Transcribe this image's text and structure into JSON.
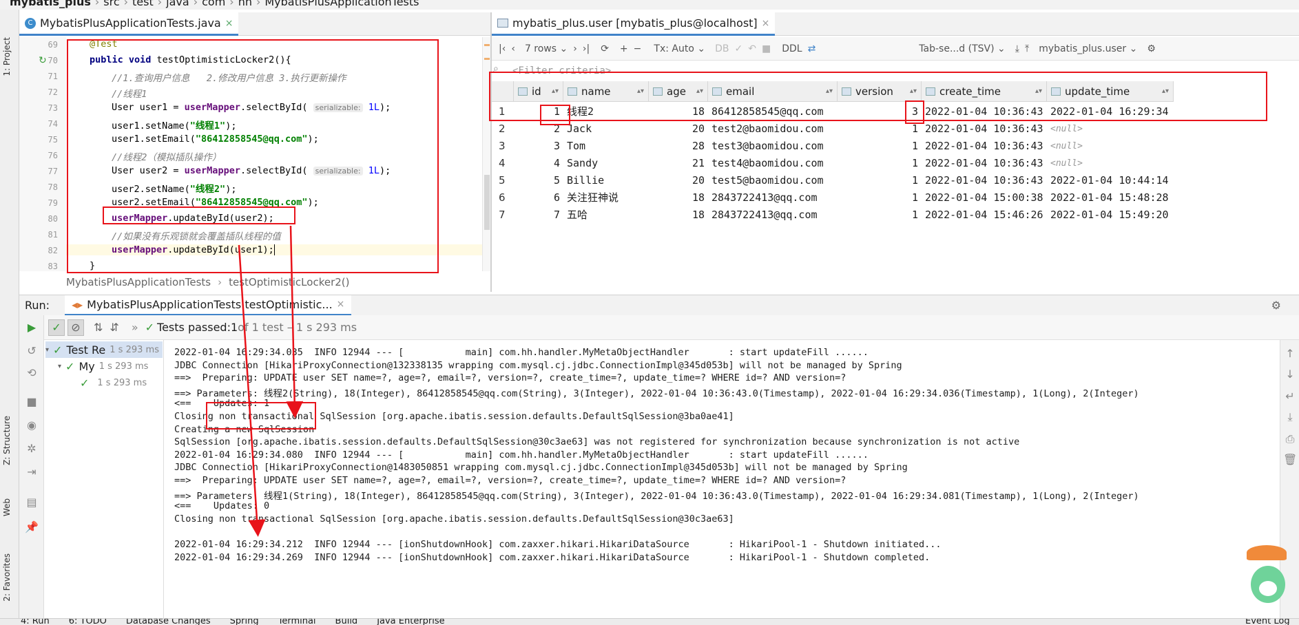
{
  "breadcrumb": [
    "mybatis_plus",
    "src",
    "test",
    "java",
    "com",
    "hh",
    "MybatisPlusApplicationTests"
  ],
  "left_stripe": {
    "project": "1: Project",
    "structure": "Z: Structure",
    "web": "Web",
    "favorites": "2: Favorites"
  },
  "editor": {
    "tab": "MybatisPlusApplicationTests.java",
    "line_numbers": [
      "69",
      "70",
      "71",
      "72",
      "73",
      "74",
      "75",
      "76",
      "77",
      "78",
      "79",
      "80",
      "81",
      "82",
      "83"
    ],
    "crumbs": [
      "MybatisPlusApplicationTests",
      "testOptimisticLocker2()"
    ],
    "code": {
      "l69": "@Test",
      "l70_kw": "public void",
      "l70_rest": " testOptimisticLocker2(){",
      "l71": "//1.查询用户信息   2.修改用户信息 3.执行更新操作",
      "l72": "//线程1",
      "l73_a": "User user1 = ",
      "l73_b": "userMapper",
      "l73_c": ".selectById( ",
      "l73_hint": "serializable:",
      "l73_d": " 1L",
      "l73_e": ");",
      "l74_a": "user1.setName(",
      "l74_b": "\"线程1\"",
      "l74_c": ");",
      "l75_a": "user1.setEmail(",
      "l75_b": "\"86412858545@qq.com\"",
      "l75_c": ");",
      "l76": "//线程2（模拟插队操作）",
      "l77_a": "User user2 = ",
      "l77_b": "userMapper",
      "l77_c": ".selectById( ",
      "l77_hint": "serializable:",
      "l77_d": " 1L",
      "l77_e": ");",
      "l78_a": "user2.setName(",
      "l78_b": "\"线程2\"",
      "l78_c": ");",
      "l79_a": "user2.setEmail(",
      "l79_b": "\"86412858545@qq.com\"",
      "l79_c": ");",
      "l80_a": "userMapper",
      "l80_b": ".updateById(user2);",
      "l81": "//如果没有乐观锁就会覆盖插队线程的值",
      "l82_a": "userMapper",
      "l82_b": ".updateById(user1);",
      "l83": "}"
    }
  },
  "db": {
    "tab": "mybatis_plus.user [mybatis_plus@localhost]",
    "toolbar": {
      "rows": "7 rows",
      "tx": "Tx: Auto",
      "ddl": "DDL",
      "format": "Tab-se...d (TSV)",
      "target": "mybatis_plus.user"
    },
    "filter_placeholder": "<Filter criteria>",
    "columns": [
      "id",
      "name",
      "age",
      "email",
      "version",
      "create_time",
      "update_time"
    ],
    "rows": [
      {
        "n": "1",
        "id": "1",
        "name": "线程2",
        "age": "18",
        "email": "86412858545@qq.com",
        "version": "3",
        "create_time": "2022-01-04 10:36:43",
        "update_time": "2022-01-04 16:29:34"
      },
      {
        "n": "2",
        "id": "2",
        "name": "Jack",
        "age": "20",
        "email": "test2@baomidou.com",
        "version": "1",
        "create_time": "2022-01-04 10:36:43",
        "update_time": "<null>"
      },
      {
        "n": "3",
        "id": "3",
        "name": "Tom",
        "age": "28",
        "email": "test3@baomidou.com",
        "version": "1",
        "create_time": "2022-01-04 10:36:43",
        "update_time": "<null>"
      },
      {
        "n": "4",
        "id": "4",
        "name": "Sandy",
        "age": "21",
        "email": "test4@baomidou.com",
        "version": "1",
        "create_time": "2022-01-04 10:36:43",
        "update_time": "<null>"
      },
      {
        "n": "5",
        "id": "5",
        "name": "Billie",
        "age": "20",
        "email": "test5@baomidou.com",
        "version": "1",
        "create_time": "2022-01-04 10:36:43",
        "update_time": "2022-01-04 10:44:14"
      },
      {
        "n": "6",
        "id": "6",
        "name": "关注狂神说",
        "age": "18",
        "email": "2843722413@qq.com",
        "version": "1",
        "create_time": "2022-01-04 15:00:38",
        "update_time": "2022-01-04 15:48:28"
      },
      {
        "n": "7",
        "id": "7",
        "name": "五哈",
        "age": "18",
        "email": "2843722413@qq.com",
        "version": "1",
        "create_time": "2022-01-04 15:46:26",
        "update_time": "2022-01-04 15:49:20"
      }
    ]
  },
  "run": {
    "label": "Run:",
    "config": "MybatisPlusApplicationTests.testOptimistic...",
    "tests_passed": "Tests passed:",
    "tests_count": " 1",
    "tests_detail": " of 1 test – 1 s 293 ms",
    "tree": [
      {
        "label": "Test Re",
        "time": "1 s 293 ms"
      },
      {
        "label": "My",
        "time": "1 s 293 ms"
      },
      {
        "label": "",
        "time": "1 s 293 ms"
      }
    ],
    "console": [
      "2022-01-04 16:29:34.035  INFO 12944 --- [           main] com.hh.handler.MyMetaObjectHandler       : start updateFill ......",
      "JDBC Connection [HikariProxyConnection@132338135 wrapping com.mysql.cj.jdbc.ConnectionImpl@345d053b] will not be managed by Spring",
      "==>  Preparing: UPDATE user SET name=?, age=?, email=?, version=?, create_time=?, update_time=? WHERE id=? AND version=?",
      "==> Parameters: 线程2(String), 18(Integer), 86412858545@qq.com(String), 3(Integer), 2022-01-04 10:36:43.0(Timestamp), 2022-01-04 16:29:34.036(Timestamp), 1(Long), 2(Integer)",
      "<==    Updates: 1",
      "Closing non transactional SqlSession [org.apache.ibatis.session.defaults.DefaultSqlSession@3ba0ae41]",
      "Creating a new SqlSession",
      "SqlSession [org.apache.ibatis.session.defaults.DefaultSqlSession@30c3ae63] was not registered for synchronization because synchronization is not active",
      "2022-01-04 16:29:34.080  INFO 12944 --- [           main] com.hh.handler.MyMetaObjectHandler       : start updateFill ......",
      "JDBC Connection [HikariProxyConnection@1483050851 wrapping com.mysql.cj.jdbc.ConnectionImpl@345d053b] will not be managed by Spring",
      "==>  Preparing: UPDATE user SET name=?, age=?, email=?, version=?, create_time=?, update_time=? WHERE id=? AND version=?",
      "==> Parameters: 线程1(String), 18(Integer), 86412858545@qq.com(String), 3(Integer), 2022-01-04 10:36:43.0(Timestamp), 2022-01-04 16:29:34.081(Timestamp), 1(Long), 2(Integer)",
      "<==    Updates: 0",
      "Closing non transactional SqlSession [org.apache.ibatis.session.defaults.DefaultSqlSession@30c3ae63]",
      "",
      "2022-01-04 16:29:34.212  INFO 12944 --- [ionShutdownHook] com.zaxxer.hikari.HikariDataSource       : HikariPool-1 - Shutdown initiated...",
      "2022-01-04 16:29:34.269  INFO 12944 --- [ionShutdownHook] com.zaxxer.hikari.HikariDataSource       : HikariPool-1 - Shutdown completed."
    ]
  },
  "bottom_tabs": [
    "4: Run",
    "6: TODO",
    "Database Changes",
    "Spring",
    "Terminal",
    "Build",
    "Java Enterprise",
    "Event Log"
  ],
  "colors": {
    "annotation_red": "#e8131a",
    "pass_green": "#3a9c3a",
    "accent_blue": "#4083c9"
  }
}
